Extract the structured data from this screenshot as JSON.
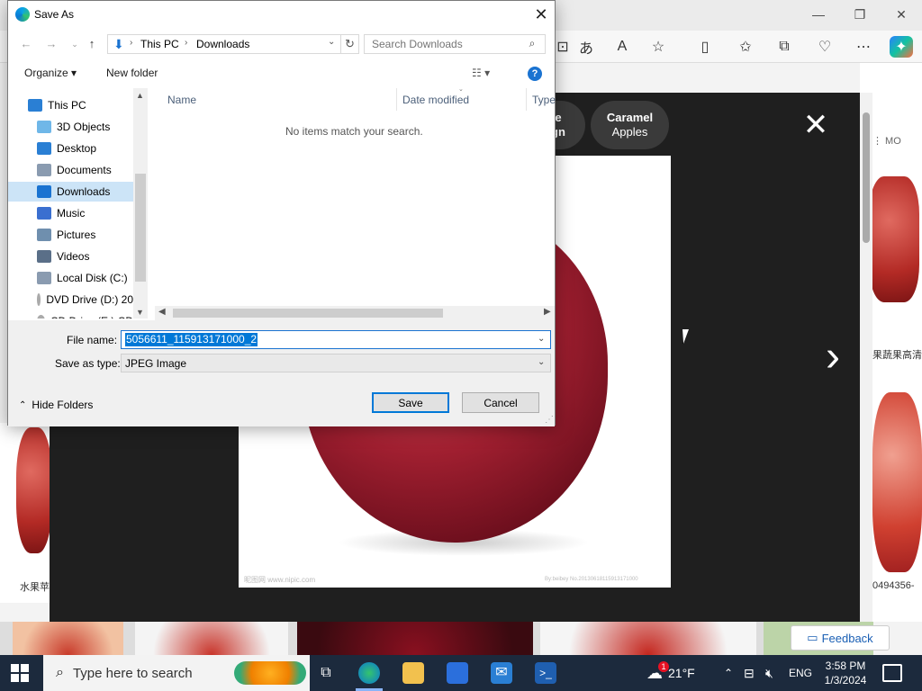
{
  "dialog": {
    "title": "Save As",
    "breadcrumbs": [
      "This PC",
      "Downloads"
    ],
    "search_placeholder": "Search Downloads",
    "toolbar": {
      "organize": "Organize ▾",
      "new_folder": "New folder"
    },
    "tree": [
      {
        "label": "This PC",
        "icon": "computer-icon",
        "selected": false
      },
      {
        "label": "3D Objects",
        "icon": "3d-objects-icon",
        "selected": false
      },
      {
        "label": "Desktop",
        "icon": "desktop-icon",
        "selected": false
      },
      {
        "label": "Documents",
        "icon": "documents-icon",
        "selected": false
      },
      {
        "label": "Downloads",
        "icon": "downloads-icon",
        "selected": true
      },
      {
        "label": "Music",
        "icon": "music-icon",
        "selected": false
      },
      {
        "label": "Pictures",
        "icon": "pictures-icon",
        "selected": false
      },
      {
        "label": "Videos",
        "icon": "videos-icon",
        "selected": false
      },
      {
        "label": "Local Disk (C:)",
        "icon": "disk-icon",
        "selected": false
      },
      {
        "label": "DVD Drive (D:) 20",
        "icon": "dvd-icon",
        "selected": false
      },
      {
        "label": "CD Drive (E:) CD",
        "icon": "cd-icon",
        "selected": false
      }
    ],
    "columns": [
      "Name",
      "Date modified",
      "Type"
    ],
    "empty_message": "No items match your search.",
    "file_name_label": "File name:",
    "file_name_value": "5056611_115913171000_2",
    "save_type_label": "Save as type:",
    "save_type_value": "JPEG Image",
    "save_button": "Save",
    "cancel_button": "Cancel",
    "hide_folders": "Hide Folders"
  },
  "viewer": {
    "chips": [
      {
        "line1": "e",
        "line2": "gn"
      },
      {
        "line1": "Caramel",
        "line2": "Apples"
      }
    ],
    "caption_left": "水果苹",
    "caption_right_top": "果蔬果高清",
    "caption_right_bottom": "0494356-",
    "right_more": "⋮ MO",
    "feedback": "Feedback",
    "watermark_left": "昵图网 www.nipic.com",
    "watermark_right": "By:beibey No.20130618115913171000"
  },
  "taskbar": {
    "search_placeholder": "Type here to search",
    "weather": "21°F",
    "weather_badge": "1",
    "language": "ENG",
    "time": "3:58 PM",
    "date": "1/3/2024"
  },
  "colors": {
    "accent": "#0078d7",
    "selection": "#cce4f7",
    "taskbar": "#1c2a3d"
  }
}
